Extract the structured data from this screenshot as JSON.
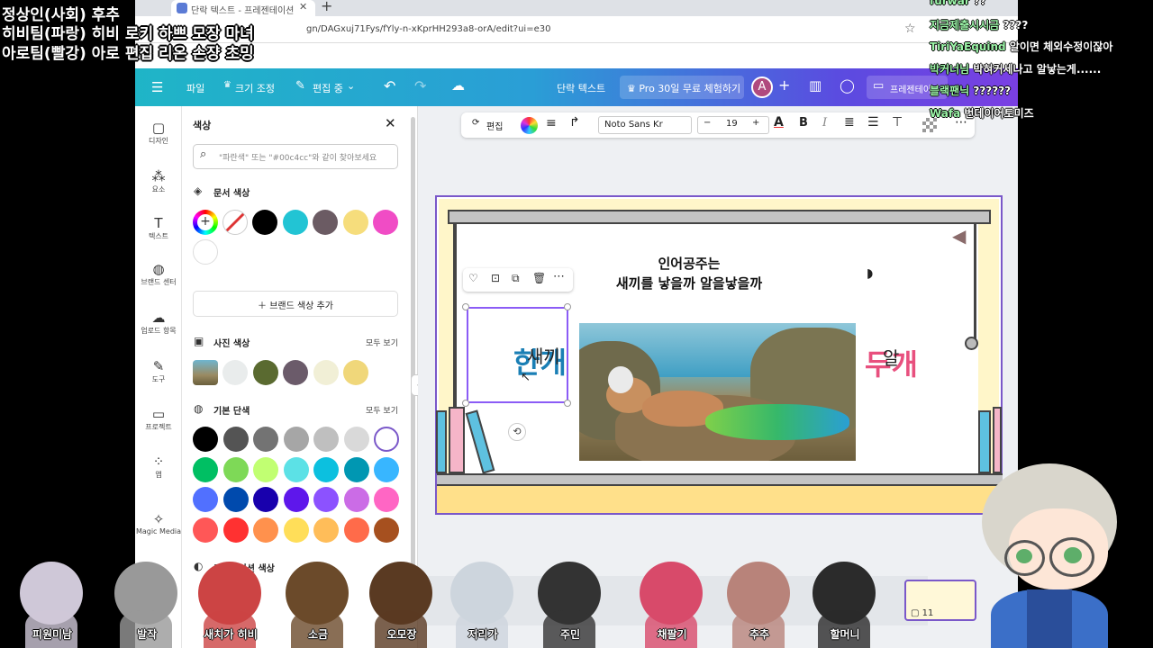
{
  "overlay": {
    "lines": [
      "정상인(사회) 후추",
      "히비팀(파랑) 히비 로키 하쁘 모장 마녀",
      "아로팀(빨강) 아로 편집 리온 손쟝 초밍"
    ]
  },
  "browser": {
    "tab_title": "단락 텍스트 - 프레젠테이션",
    "url": "gn/DAGxuj71Fys/fYly-n-xKprHH293a8-orA/edit?ui=e30"
  },
  "header": {
    "file": "파일",
    "resize": "크기 조정",
    "edit_mode": "편집 중",
    "doc_title": "단락 텍스트",
    "pro_trial": "Pro 30일 무료 체험하기",
    "avatar_letter": "A",
    "present": "프레젠테이션"
  },
  "rail": [
    {
      "label": "디자인",
      "icon": "design-icon",
      "glyph": "▢"
    },
    {
      "label": "요소",
      "icon": "elements-icon",
      "glyph": "⁂"
    },
    {
      "label": "텍스트",
      "icon": "text-icon",
      "glyph": "T"
    },
    {
      "label": "브랜드 센터",
      "icon": "brand-icon",
      "glyph": "◍"
    },
    {
      "label": "업로드 항목",
      "icon": "upload-icon",
      "glyph": "☁"
    },
    {
      "label": "도구",
      "icon": "tools-icon",
      "glyph": "✎"
    },
    {
      "label": "프로젝트",
      "icon": "projects-icon",
      "glyph": "▭"
    },
    {
      "label": "앱",
      "icon": "apps-icon",
      "glyph": "⁘"
    },
    {
      "label": "Magic Media",
      "icon": "magic-media-icon",
      "glyph": "✧"
    }
  ],
  "panel": {
    "title": "색상",
    "search_placeholder": "\"파란색\" 또는 \"#00c4cc\"와 같이 찾아보세요",
    "doc_colors_title": "문서 색상",
    "doc_colors": [
      "#000000",
      "#22c4d4",
      "#6b5b63",
      "#f6dd7c",
      "#f04cc5",
      "#ffffff"
    ],
    "add_brand": "브랜드 색상 추가",
    "photo_colors_title": "사진 색상",
    "photo_colors": [
      "#e9ecec",
      "#5a6a30",
      "#6b5b6a",
      "#f1efd6",
      "#f0d77a"
    ],
    "see_all": "모두 보기",
    "solid_title": "기본 단색",
    "solid_colors": [
      [
        "#000000",
        "#545454",
        "#737373",
        "#a6a6a6",
        "#bfbfbf",
        "#d9d9d9",
        "#ffffff"
      ],
      [
        "#00bf63",
        "#7ed957",
        "#c1ff72",
        "#5ce1e6",
        "#0cc0df",
        "#0097b2",
        "#38b6ff"
      ],
      [
        "#5170ff",
        "#004aad",
        "#1800ad",
        "#5e17eb",
        "#8c52ff",
        "#cb6ce6",
        "#ff66c4"
      ],
      [
        "#ff5757",
        "#ff3131",
        "#ff914d",
        "#ffde59",
        "#ffbd59",
        "#ff6b4a",
        "#a6501f"
      ]
    ],
    "gradient_title": "그라데이션 색상"
  },
  "toolbar": {
    "edit": "편집",
    "font": "Noto Sans Kr",
    "size": "19",
    "minus": "−",
    "plus": "+"
  },
  "slide": {
    "question_line1": "인어공주는",
    "question_line2": "새끼를 낳을까 알을낳을까",
    "word_left_big": "한개",
    "word_left_small": "새끼",
    "word_right_big": "두개",
    "word_right_small": "알"
  },
  "chat": [
    {
      "user": "furwar",
      "msg": "??"
    },
    {
      "user": "지금제출시시금",
      "msg": "????"
    },
    {
      "user": "TiriYaEquind",
      "msg": "알이면 체외수정이잖아"
    },
    {
      "user": "박커너님",
      "msg": "박혀커세나고 알낳는게......"
    },
    {
      "user": "블랙팬닉",
      "msg": "??????"
    },
    {
      "user": "Wafa",
      "msg": "번데이어토미즈"
    }
  ],
  "viewers": [
    "피원미남",
    "발작",
    "새치가 히비",
    "소금",
    "오모장",
    "저리가",
    "주민",
    "채팔기",
    "추추",
    "할머니"
  ]
}
